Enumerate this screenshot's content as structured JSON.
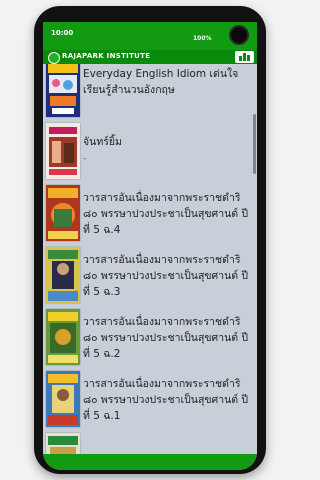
{
  "status_bar": {
    "time": "10:00",
    "battery": "100%"
  },
  "app_bar": {
    "title": "RAJAPARK INSTITUTE"
  },
  "books": [
    {
      "title": "Everyday English Idiom เด่นใจ เรียนรู้สำนวนอังกฤษ",
      "subtitle": "-"
    },
    {
      "title": "จันทร์ยิ้ม",
      "subtitle": "-"
    },
    {
      "title": "วารสารอันเนื่องมาจากพระราชดำริ ๘๐ พรรษาปวงประชาเป็นสุขศานต์ ปีที่ 5 ฉ.4",
      "subtitle": "-"
    },
    {
      "title": "วารสารอันเนื่องมาจากพระราชดำริ ๘๐ พรรษาปวงประชาเป็นสุขศานต์ ปีที่ 5 ฉ.3",
      "subtitle": "-"
    },
    {
      "title": "วารสารอันเนื่องมาจากพระราชดำริ ๘๐ พรรษาปวงประชาเป็นสุขศานต์ ปีที่ 5 ฉ.2",
      "subtitle": "-"
    },
    {
      "title": "วารสารอันเนื่องมาจากพระราชดำริ ๘๐ พรรษาปวงประชาเป็นสุขศานต์ ปีที่ 5 ฉ.1",
      "subtitle": "-"
    }
  ],
  "colors": {
    "primary": "#129a12",
    "list_background": "#c8cfd8"
  }
}
